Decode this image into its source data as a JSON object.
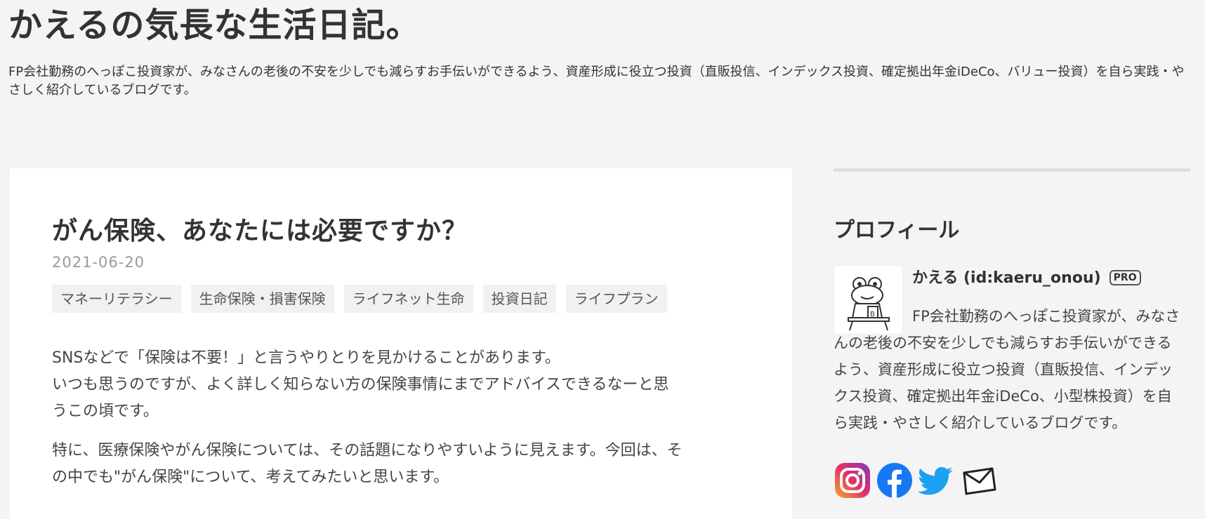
{
  "header": {
    "site_title": "かえるの気長な生活日記。",
    "site_description": "FP会社勤務のへっぽこ投資家が、みなさんの老後の不安を少しでも減らすお手伝いができるよう、資産形成に役立つ投資（直販投信、インデックス投資、確定拠出年金iDeCo、バリュー投資）を自ら実践・やさしく紹介しているブログです。"
  },
  "article": {
    "title": "がん保険、あなたには必要ですか？",
    "date": "2021-06-20",
    "tags": [
      "マネーリテラシー",
      "生命保険・損害保険",
      "ライフネット生命",
      "投資日記",
      "ライフプラン"
    ],
    "paragraphs": [
      "SNSなどで「保険は不要！」と言うやりとりを見かけることがあります。\nいつも思うのですが、よく詳しく知らない方の保険事情にまでアドバイスできるなーと思うこの頃です。",
      "特に、医療保険やがん保険については、その話題になりやすいように見えます。今回は、その中でも\"がん保険\"について、考えてみたいと思います。"
    ]
  },
  "sidebar": {
    "profile_heading": "プロフィール",
    "profile_name": "かえる (id:kaeru_onou)",
    "pro_badge": "PRO",
    "profile_description": "FP会社勤務のへっぽこ投資家が、みなさんの老後の不安を少しでも減らすお手伝いができるよう、資産形成に役立つ投資（直販投信、インデックス投資、確定拠出年金iDeCo、小型株投資）を自ら実践・やさしく紹介しているブログです。",
    "social_icons": [
      "instagram-icon",
      "facebook-icon",
      "twitter-icon",
      "mail-icon"
    ]
  },
  "colors": {
    "page_background": "#f4f4f4",
    "card_background": "#ffffff",
    "tag_background": "#f1f1f1",
    "facebook": "#1877f2",
    "twitter": "#1da1f2"
  }
}
